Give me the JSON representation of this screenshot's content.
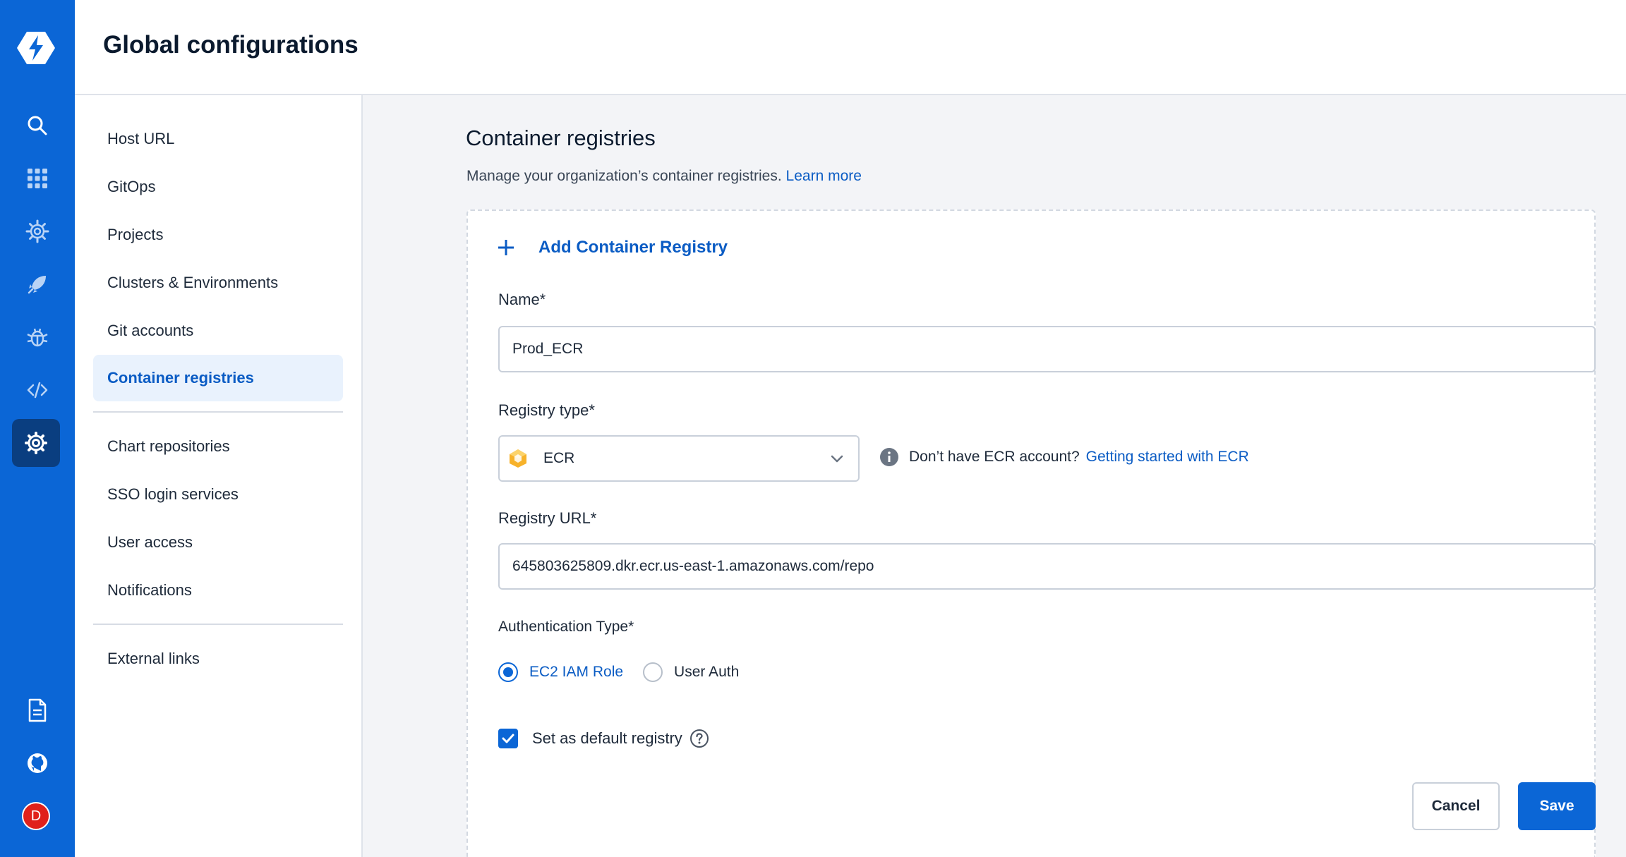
{
  "header": {
    "title": "Global configurations"
  },
  "rail": {
    "avatar_initial": "D",
    "accent": "#0b66d6",
    "icons": [
      "app-logo-icon",
      "search-icon",
      "apps-grid-icon",
      "cog-outline-icon",
      "rocket-icon",
      "bug-icon",
      "code-icon",
      "settings-gear-icon",
      "document-icon",
      "github-icon"
    ]
  },
  "nav": {
    "items": [
      {
        "label": "Host URL"
      },
      {
        "label": "GitOps"
      },
      {
        "label": "Projects"
      },
      {
        "label": "Clusters & Environments"
      },
      {
        "label": "Git accounts"
      },
      {
        "label": "Container registries",
        "active": true
      },
      {
        "label": "Chart repositories"
      },
      {
        "label": "SSO login services"
      },
      {
        "label": "User access"
      },
      {
        "label": "Notifications"
      },
      {
        "label": "External links"
      }
    ]
  },
  "main": {
    "title": "Container registries",
    "description": "Manage your organization’s container registries.",
    "learn_more": "Learn more"
  },
  "form": {
    "add_label": "Add Container Registry",
    "name_label": "Name*",
    "name_value": "Prod_ECR",
    "type_label": "Registry type*",
    "type_value": "ECR",
    "hint_text": "Don’t have ECR account?",
    "hint_link": "Getting started with ECR",
    "url_label": "Registry URL*",
    "url_value": "645803625809.dkr.ecr.us-east-1.amazonaws.com/repo",
    "auth_label": "Authentication Type*",
    "auth_option_1": "EC2 IAM Role",
    "auth_option_2": "User Auth",
    "auth_selected": "EC2 IAM Role",
    "default_label": "Set as default registry",
    "default_checked": true,
    "cancel_label": "Cancel",
    "save_label": "Save"
  }
}
